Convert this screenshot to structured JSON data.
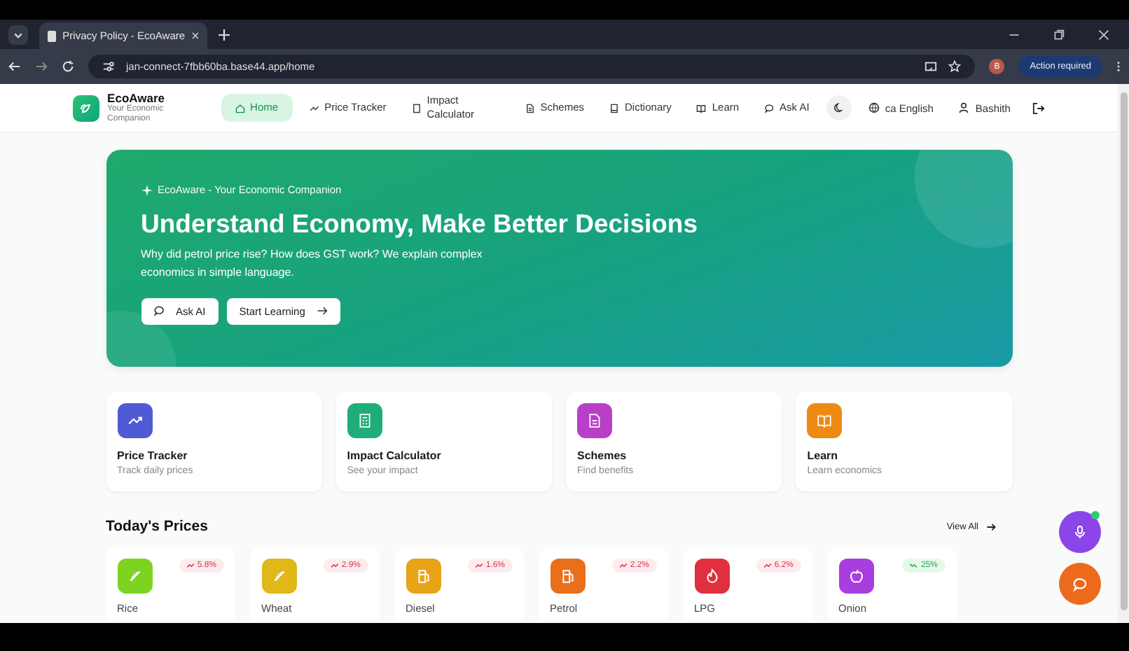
{
  "browser": {
    "tab_title": "Privacy Policy - EcoAware",
    "url": "jan-connect-7fbb60ba.base44.app/home",
    "profile_initial": "B",
    "action_label": "Action required"
  },
  "nav": {
    "brand": "EcoAware",
    "tagline": "Your Economic Companion",
    "items": [
      {
        "label": "Home",
        "selected": true
      },
      {
        "label": "Price Tracker",
        "selected": false
      },
      {
        "label": "Impact Calculator",
        "selected": false
      },
      {
        "label": "Schemes",
        "selected": false
      },
      {
        "label": "Dictionary",
        "selected": false
      },
      {
        "label": "Learn",
        "selected": false
      },
      {
        "label": "Ask AI",
        "selected": false
      }
    ],
    "language": "ca English",
    "user": "Bashith"
  },
  "hero": {
    "eyebrow": "EcoAware - Your Economic Companion",
    "title": "Understand Economy, Make Better Decisions",
    "subtitle": "Why did petrol price rise? How does GST work? We explain complex economics in simple language.",
    "buttons": [
      "Ask AI",
      "Start Learning"
    ]
  },
  "features": [
    {
      "title": "Price Tracker",
      "subtitle": "Track daily prices",
      "color": "#4f5bd5"
    },
    {
      "title": "Impact Calculator",
      "subtitle": "See your impact",
      "color": "#1fae7a"
    },
    {
      "title": "Schemes",
      "subtitle": "Find benefits",
      "color": "#b93fc9"
    },
    {
      "title": "Learn",
      "subtitle": "Learn economics",
      "color": "#ec8a14"
    }
  ],
  "prices": {
    "title": "Today's Prices",
    "view_all": "View All",
    "items": [
      {
        "name": "Rice",
        "change": "5.8%",
        "rising": true,
        "color": "#7ed321"
      },
      {
        "name": "Wheat",
        "change": "2.9%",
        "rising": true,
        "color": "#e0b81a"
      },
      {
        "name": "Diesel",
        "change": "1.6%",
        "rising": true,
        "color": "#e8a317"
      },
      {
        "name": "Petrol",
        "change": "2.2%",
        "rising": true,
        "color": "#ea6f1a"
      },
      {
        "name": "LPG",
        "change": "6.2%",
        "rising": true,
        "color": "#e0303f"
      },
      {
        "name": "Onion",
        "change": "25%",
        "rising": false,
        "color": "#a93ee0"
      }
    ]
  }
}
